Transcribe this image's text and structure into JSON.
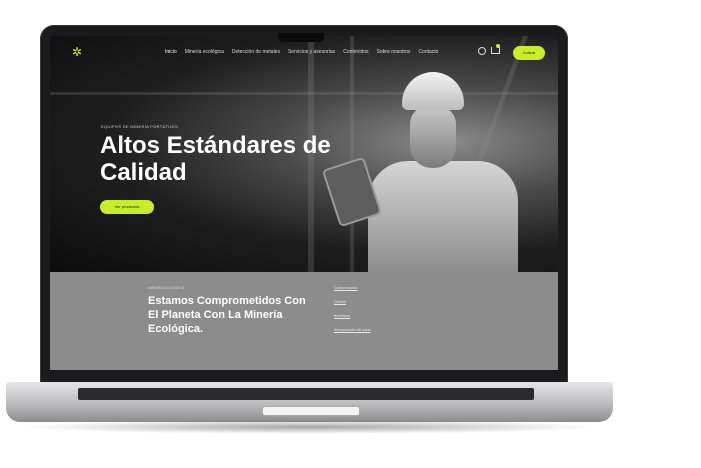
{
  "nav": {
    "links": [
      "Inicio",
      "Minería ecológica",
      "Detección de metales",
      "Servicios y asesorías",
      "Contenidos",
      "Sobre nosotros",
      "Contacto"
    ],
    "cta_label": "Cotizar"
  },
  "hero": {
    "eyebrow": "EQUIPOS DE MINERÍA PORTÁTILES",
    "title": "Altos Estándares de Calidad",
    "button_label": "Ver productos"
  },
  "section": {
    "eyebrow": "MINERÍA ECOLÓGICA",
    "title": "Estamos Comprometidos Con El Planeta Con La Minería Ecológica.",
    "links": [
      "Contaminación",
      "Calidad",
      "Beneficios",
      "Recuperación del suelo"
    ]
  },
  "colors": {
    "accent": "#c8ee2a",
    "section_bg": "#8c8c8c"
  }
}
